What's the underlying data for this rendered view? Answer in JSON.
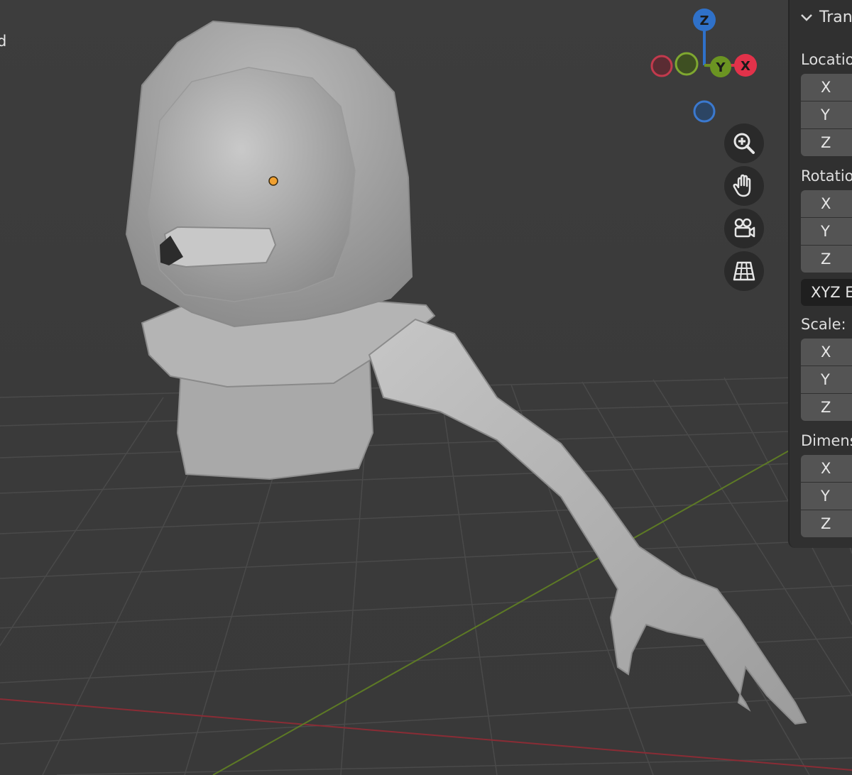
{
  "viewport": {
    "header_text_partial": "d",
    "gizmo": {
      "z_label": "Z",
      "y_label": "Y",
      "x_label": "X",
      "colors": {
        "x": "#e2324a",
        "y": "#6b9422",
        "z": "#2f71c9"
      }
    },
    "nav_buttons": [
      {
        "name": "zoom-button",
        "icon": "zoom-in-icon"
      },
      {
        "name": "pan-button",
        "icon": "hand-icon"
      },
      {
        "name": "camera-view-button",
        "icon": "camera-icon"
      },
      {
        "name": "ortho-toggle-button",
        "icon": "grid-perspective-icon"
      }
    ],
    "origin_marker_color": "#f0a030"
  },
  "sidebar": {
    "section_title": "Trans",
    "location": {
      "label": "Location",
      "axes": [
        "X",
        "Y",
        "Z"
      ]
    },
    "rotation": {
      "label": "Rotation",
      "axes": [
        "X",
        "Y",
        "Z"
      ]
    },
    "rotation_mode": "XYZ E",
    "scale": {
      "label": "Scale:",
      "axes": [
        "X",
        "Y",
        "Z"
      ]
    },
    "dimensions": {
      "label": "Dimens",
      "axes": [
        "X",
        "Y",
        "Z"
      ]
    }
  }
}
